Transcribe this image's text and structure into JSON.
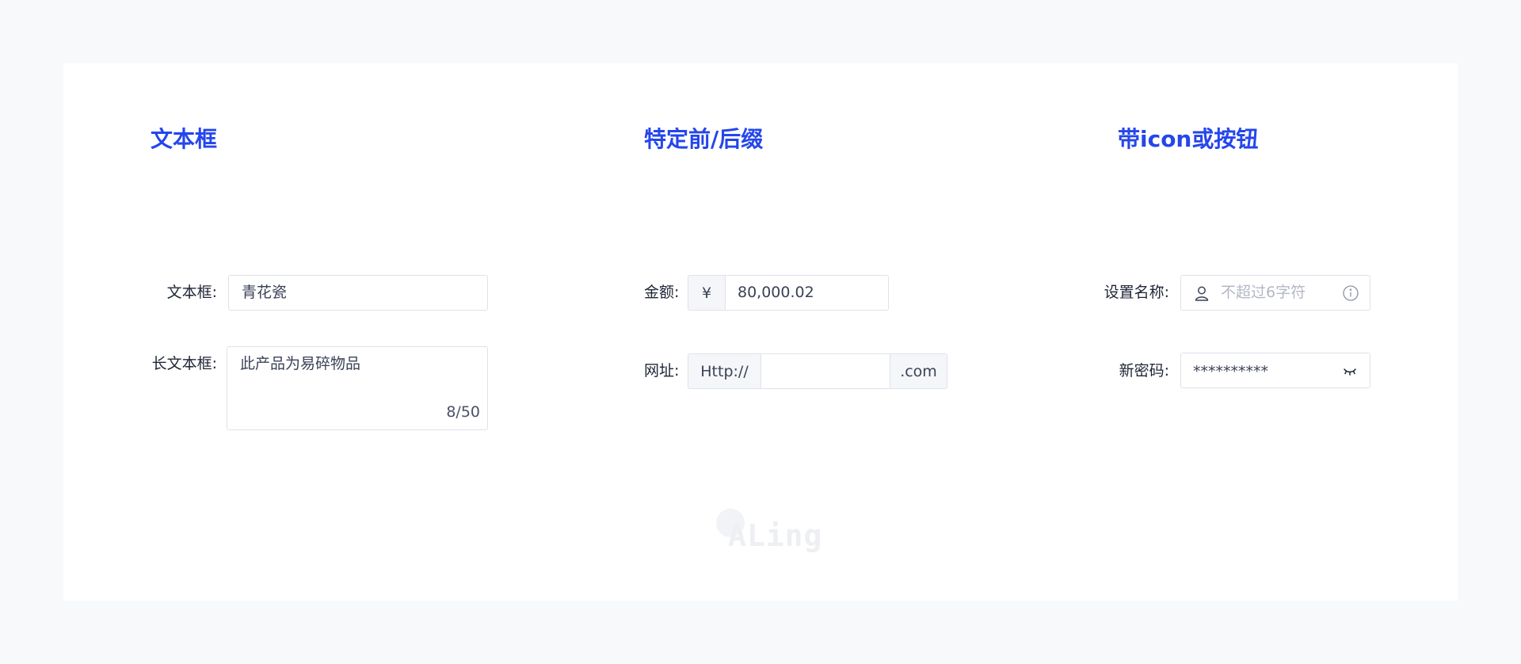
{
  "sections": {
    "textbox": {
      "title": "文本框",
      "field1_label": "文本框:",
      "field1_value": "青花瓷",
      "field2_label": "长文本框:",
      "field2_value": "此产品为易碎物品",
      "field2_counter": "8/50"
    },
    "affix": {
      "title": "特定前/后缀",
      "amount_label": "金额:",
      "amount_prefix": "¥",
      "amount_value": "80,000.02",
      "url_label": "网址:",
      "url_prefix": "Http://",
      "url_value": "",
      "url_suffix": ".com"
    },
    "icon_button": {
      "title": "带icon或按钮",
      "name_label": "设置名称:",
      "name_placeholder": "不超过6字符",
      "password_label": "新密码:",
      "password_value": "**********"
    }
  },
  "watermark": "ALing",
  "colors": {
    "accent": "#2546ec",
    "page_background": "#f8f9fb",
    "card_background": "#ffffff",
    "border": "#dfe2e8",
    "addon_background": "#f5f6f9",
    "placeholder": "#b3b8c4"
  },
  "icons": {
    "name_prefix": "user-icon",
    "name_suffix": "info-icon",
    "password_suffix": "eye-closed-icon"
  }
}
